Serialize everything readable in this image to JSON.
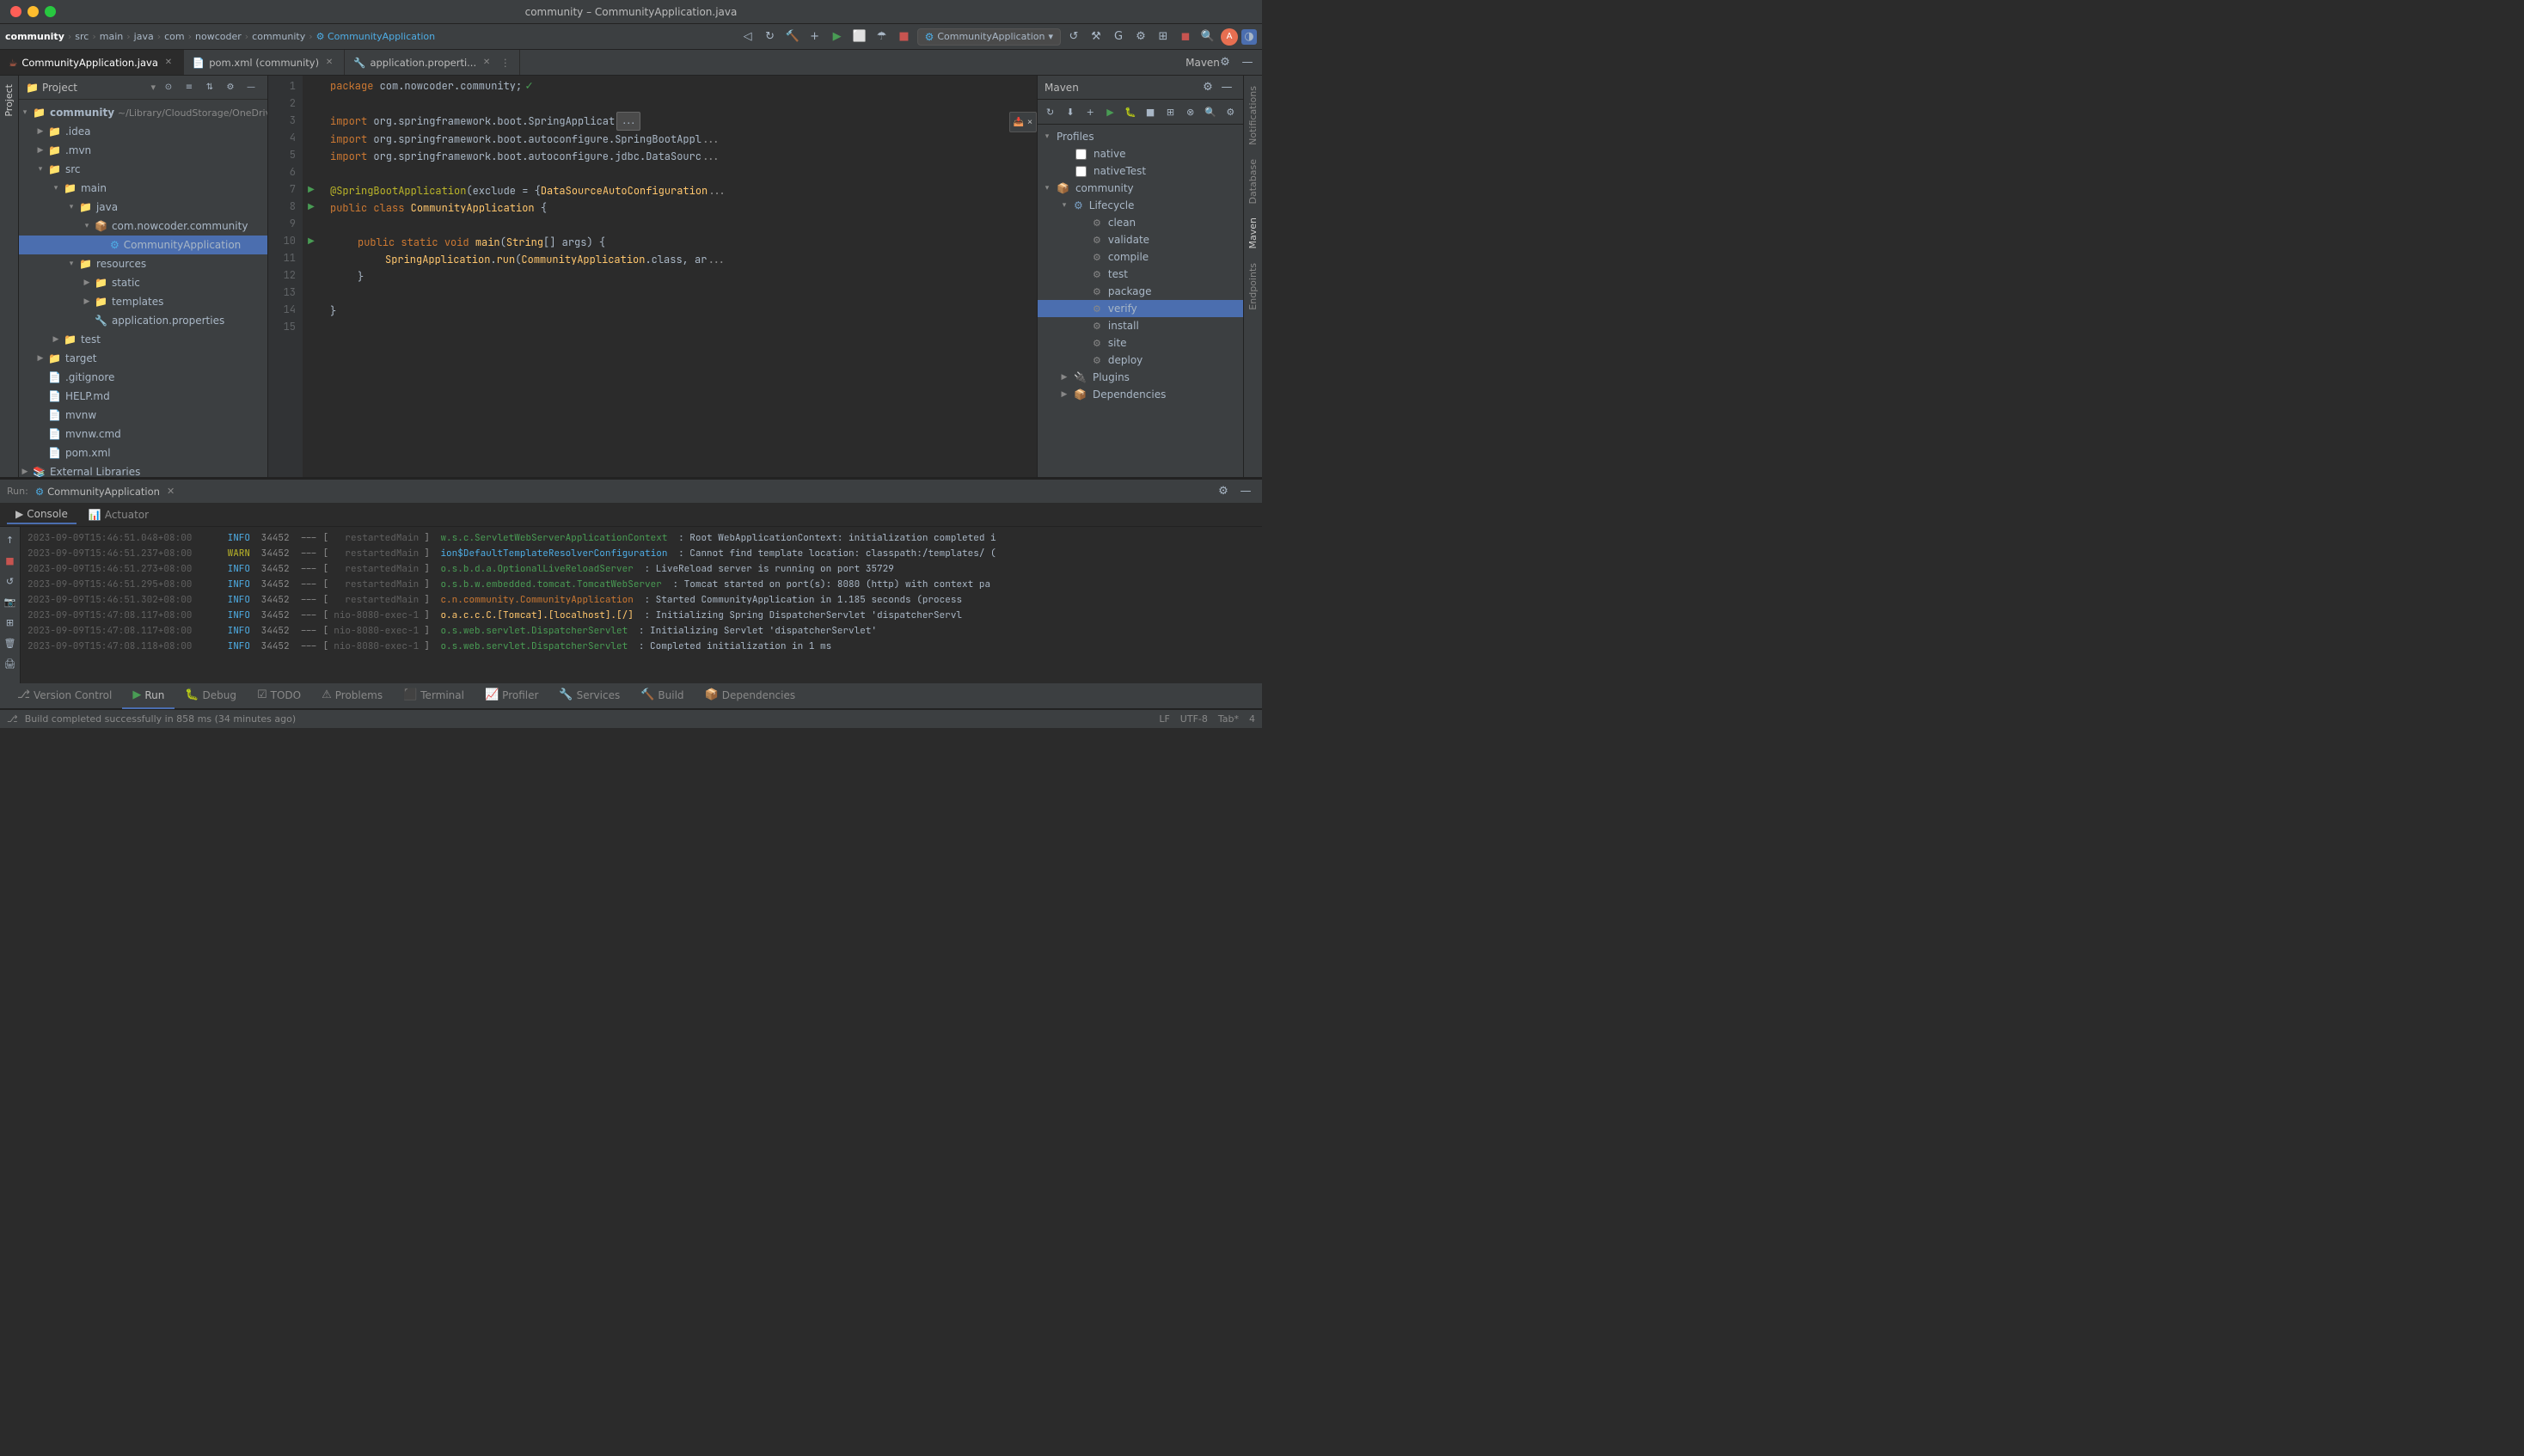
{
  "titleBar": {
    "title": "community – CommunityApplication.java"
  },
  "navBar": {
    "breadcrumbs": [
      "community",
      "src",
      "main",
      "java",
      "com",
      "nowcoder",
      "community"
    ],
    "activeItem": "CommunityApplication",
    "runConfig": "CommunityApplication",
    "icons": [
      "back",
      "forward",
      "refresh",
      "build",
      "run",
      "debug",
      "coverage",
      "profile",
      "stop",
      "run-config",
      "search",
      "avatar",
      "theme"
    ]
  },
  "tabs": [
    {
      "name": "CommunityApplication.java",
      "icon": "java",
      "active": true
    },
    {
      "name": "pom.xml (community)",
      "icon": "xml",
      "active": false
    },
    {
      "name": "application.properti...",
      "icon": "prop",
      "active": false
    }
  ],
  "sidebar": {
    "title": "Project",
    "tree": [
      {
        "level": 0,
        "type": "root",
        "label": "community",
        "sub": "~/Library/CloudStorage/OneDrive-↑",
        "expanded": true
      },
      {
        "level": 1,
        "type": "folder",
        "label": ".idea",
        "expanded": false
      },
      {
        "level": 1,
        "type": "folder",
        "label": ".mvn",
        "expanded": false
      },
      {
        "level": 1,
        "type": "folder",
        "label": "src",
        "expanded": true
      },
      {
        "level": 2,
        "type": "folder",
        "label": "main",
        "expanded": true
      },
      {
        "level": 3,
        "type": "folder",
        "label": "java",
        "expanded": true
      },
      {
        "level": 4,
        "type": "folder",
        "label": "com.nowcoder.community",
        "expanded": true
      },
      {
        "level": 5,
        "type": "javafile",
        "label": "CommunityApplication",
        "selected": true
      },
      {
        "level": 3,
        "type": "folder",
        "label": "resources",
        "expanded": true
      },
      {
        "level": 4,
        "type": "folder",
        "label": "static",
        "expanded": false
      },
      {
        "level": 4,
        "type": "folder",
        "label": "templates",
        "expanded": false
      },
      {
        "level": 4,
        "type": "propfile",
        "label": "application.properties"
      },
      {
        "level": 2,
        "type": "folder",
        "label": "test",
        "expanded": false
      },
      {
        "level": 1,
        "type": "folder",
        "label": "target",
        "expanded": false
      },
      {
        "level": 1,
        "type": "textfile",
        "label": ".gitignore"
      },
      {
        "level": 1,
        "type": "textfile",
        "label": "HELP.md"
      },
      {
        "level": 1,
        "type": "textfile",
        "label": "mvnw"
      },
      {
        "level": 1,
        "type": "textfile",
        "label": "mvnw.cmd"
      },
      {
        "level": 1,
        "type": "xmlfile",
        "label": "pom.xml"
      },
      {
        "level": 0,
        "type": "folder",
        "label": "External Libraries",
        "expanded": false
      }
    ]
  },
  "editor": {
    "filename": "CommunityApplication.java",
    "lines": [
      {
        "num": 1,
        "code": "package com.nowcoder.community;"
      },
      {
        "num": 2,
        "code": ""
      },
      {
        "num": 3,
        "code": "import org.springframework.boot.SpringApplicat..."
      },
      {
        "num": 4,
        "code": "import org.springframework.boot.autoconfigure.SpringBootAppl..."
      },
      {
        "num": 5,
        "code": "import org.springframework.boot.autoconfigure.jdbc.DataSourc..."
      },
      {
        "num": 6,
        "code": ""
      },
      {
        "num": 7,
        "code": "@SpringBootApplication(exclude = {DataSourceAutoConfiguration..."
      },
      {
        "num": 8,
        "code": "public class CommunityApplication {"
      },
      {
        "num": 9,
        "code": ""
      },
      {
        "num": 10,
        "code": "    public static void main(String[] args) {"
      },
      {
        "num": 11,
        "code": "        SpringApplication.run(CommunityApplication.class, ar..."
      },
      {
        "num": 12,
        "code": "    }"
      },
      {
        "num": 13,
        "code": ""
      },
      {
        "num": 14,
        "code": "}"
      },
      {
        "num": 15,
        "code": ""
      }
    ]
  },
  "maven": {
    "title": "Maven",
    "sections": [
      {
        "name": "Profiles",
        "expanded": true,
        "items": [
          {
            "name": "native",
            "type": "checkbox"
          },
          {
            "name": "nativeTest",
            "type": "checkbox"
          }
        ]
      },
      {
        "name": "community",
        "expanded": true,
        "items": [
          {
            "name": "Lifecycle",
            "expanded": true,
            "items": [
              {
                "name": "clean"
              },
              {
                "name": "validate"
              },
              {
                "name": "compile"
              },
              {
                "name": "test"
              },
              {
                "name": "package"
              },
              {
                "name": "verify",
                "selected": true
              },
              {
                "name": "install"
              },
              {
                "name": "site"
              },
              {
                "name": "deploy"
              }
            ]
          },
          {
            "name": "Plugins",
            "expanded": false
          },
          {
            "name": "Dependencies",
            "expanded": false
          }
        ]
      }
    ]
  },
  "runBar": {
    "label": "Run:",
    "config": "CommunityApplication",
    "tabs": [
      "Console",
      "Actuator"
    ]
  },
  "console": {
    "lines": [
      {
        "ts": "2023-09-09T15:46:51.048+08:00",
        "level": "INFO",
        "pid": "34452",
        "thread": "restartedMain",
        "class": "w.s.c.ServletWebServerApplicationContext",
        "msg": ": Root WebApplicationContext: initialization completed i"
      },
      {
        "ts": "2023-09-09T15:46:51.237+08:00",
        "level": "WARN",
        "pid": "34452",
        "thread": "restartedMain",
        "class": "ion$DefaultTemplateResolverConfiguration",
        "msg": ": Cannot find template location: classpath:/templates/ ("
      },
      {
        "ts": "2023-09-09T15:46:51.273+08:00",
        "level": "INFO",
        "pid": "34452",
        "thread": "restartedMain",
        "class": "o.s.b.d.a.OptionalLiveReloadServer",
        "msg": ": LiveReload server is running on port 35729"
      },
      {
        "ts": "2023-09-09T15:46:51.295+08:00",
        "level": "INFO",
        "pid": "34452",
        "thread": "restartedMain",
        "class": "o.s.b.w.embedded.tomcat.TomcatWebServer",
        "msg": ": Tomcat started on port(s): 8080 (http) with context pa"
      },
      {
        "ts": "2023-09-09T15:46:51.302+08:00",
        "level": "INFO",
        "pid": "34452",
        "thread": "restartedMain",
        "class": "c.n.community.CommunityApplication",
        "msg": ": Started CommunityApplication in 1.185 seconds (process"
      },
      {
        "ts": "2023-09-09T15:47:08.117+08:00",
        "level": "INFO",
        "pid": "34452",
        "thread": "nio-8080-exec-1",
        "class": "o.a.c.c.C.[Tomcat].[localhost].[/]",
        "msg": ": Initializing Spring DispatcherServlet 'dispatcherServl"
      },
      {
        "ts": "2023-09-09T15:47:08.117+08:00",
        "level": "INFO",
        "pid": "34452",
        "thread": "nio-8080-exec-1",
        "class": "o.s.web.servlet.DispatcherServlet",
        "msg": ": Initializing Servlet 'dispatcherServlet'"
      },
      {
        "ts": "2023-09-09T15:47:08.118+08:00",
        "level": "INFO",
        "pid": "34452",
        "thread": "nio-8080-exec-1",
        "class": "o.s.web.servlet.DispatcherServlet",
        "msg": ": Completed initialization in 1 ms"
      }
    ]
  },
  "bottomTabs": [
    {
      "label": "Version Control",
      "icon": "vc"
    },
    {
      "label": "Run",
      "icon": "run",
      "active": true
    },
    {
      "label": "Debug",
      "icon": "debug"
    },
    {
      "label": "TODO",
      "icon": "todo"
    },
    {
      "label": "Problems",
      "icon": "problems"
    },
    {
      "label": "Terminal",
      "icon": "terminal"
    },
    {
      "label": "Profiler",
      "icon": "profiler"
    },
    {
      "label": "Services",
      "icon": "services"
    },
    {
      "label": "Build",
      "icon": "build"
    },
    {
      "label": "Dependencies",
      "icon": "deps"
    }
  ],
  "statusBar": {
    "left": "Build completed successfully in 858 ms (34 minutes ago)",
    "right": [
      "LF",
      "UTF-8",
      "Tab*",
      "4"
    ]
  },
  "rightTabs": [
    "Notifications",
    "Database",
    "Maven",
    "Endpoints"
  ]
}
